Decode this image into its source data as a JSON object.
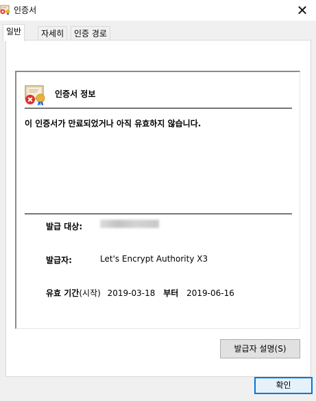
{
  "window": {
    "title": "인증서",
    "close_glyph": "✕",
    "title_icon": "certificate-icon"
  },
  "tabs": [
    {
      "label": "일반",
      "active": true
    },
    {
      "label": "자세히",
      "active": false
    },
    {
      "label": "인증 경로",
      "active": false
    }
  ],
  "general": {
    "section_title": "인증서 정보",
    "cert_icon": "invalid-certificate-icon",
    "warning": "이 인증서가 만료되었거나 아직 유효하지 않습니다.",
    "issued_to_label": "발급 대상:",
    "issued_by_label": "발급자:",
    "issued_by_value": "Let's Encrypt Authority X3",
    "validity_label": "유효 기간",
    "validity_suffix": "(시작)",
    "valid_from": "2019-03-18",
    "to_word": "부터",
    "valid_to": "2019-06-16",
    "issuer_statement_button": "발급자 설명(S)"
  },
  "footer": {
    "ok_button": "확인"
  },
  "colors": {
    "dialog_bg": "#f0f0f0",
    "panel_bg": "#ffffff",
    "ok_border": "#0078d7",
    "error_red": "#d9342b",
    "ribbon_blue": "#2a6fd6"
  }
}
